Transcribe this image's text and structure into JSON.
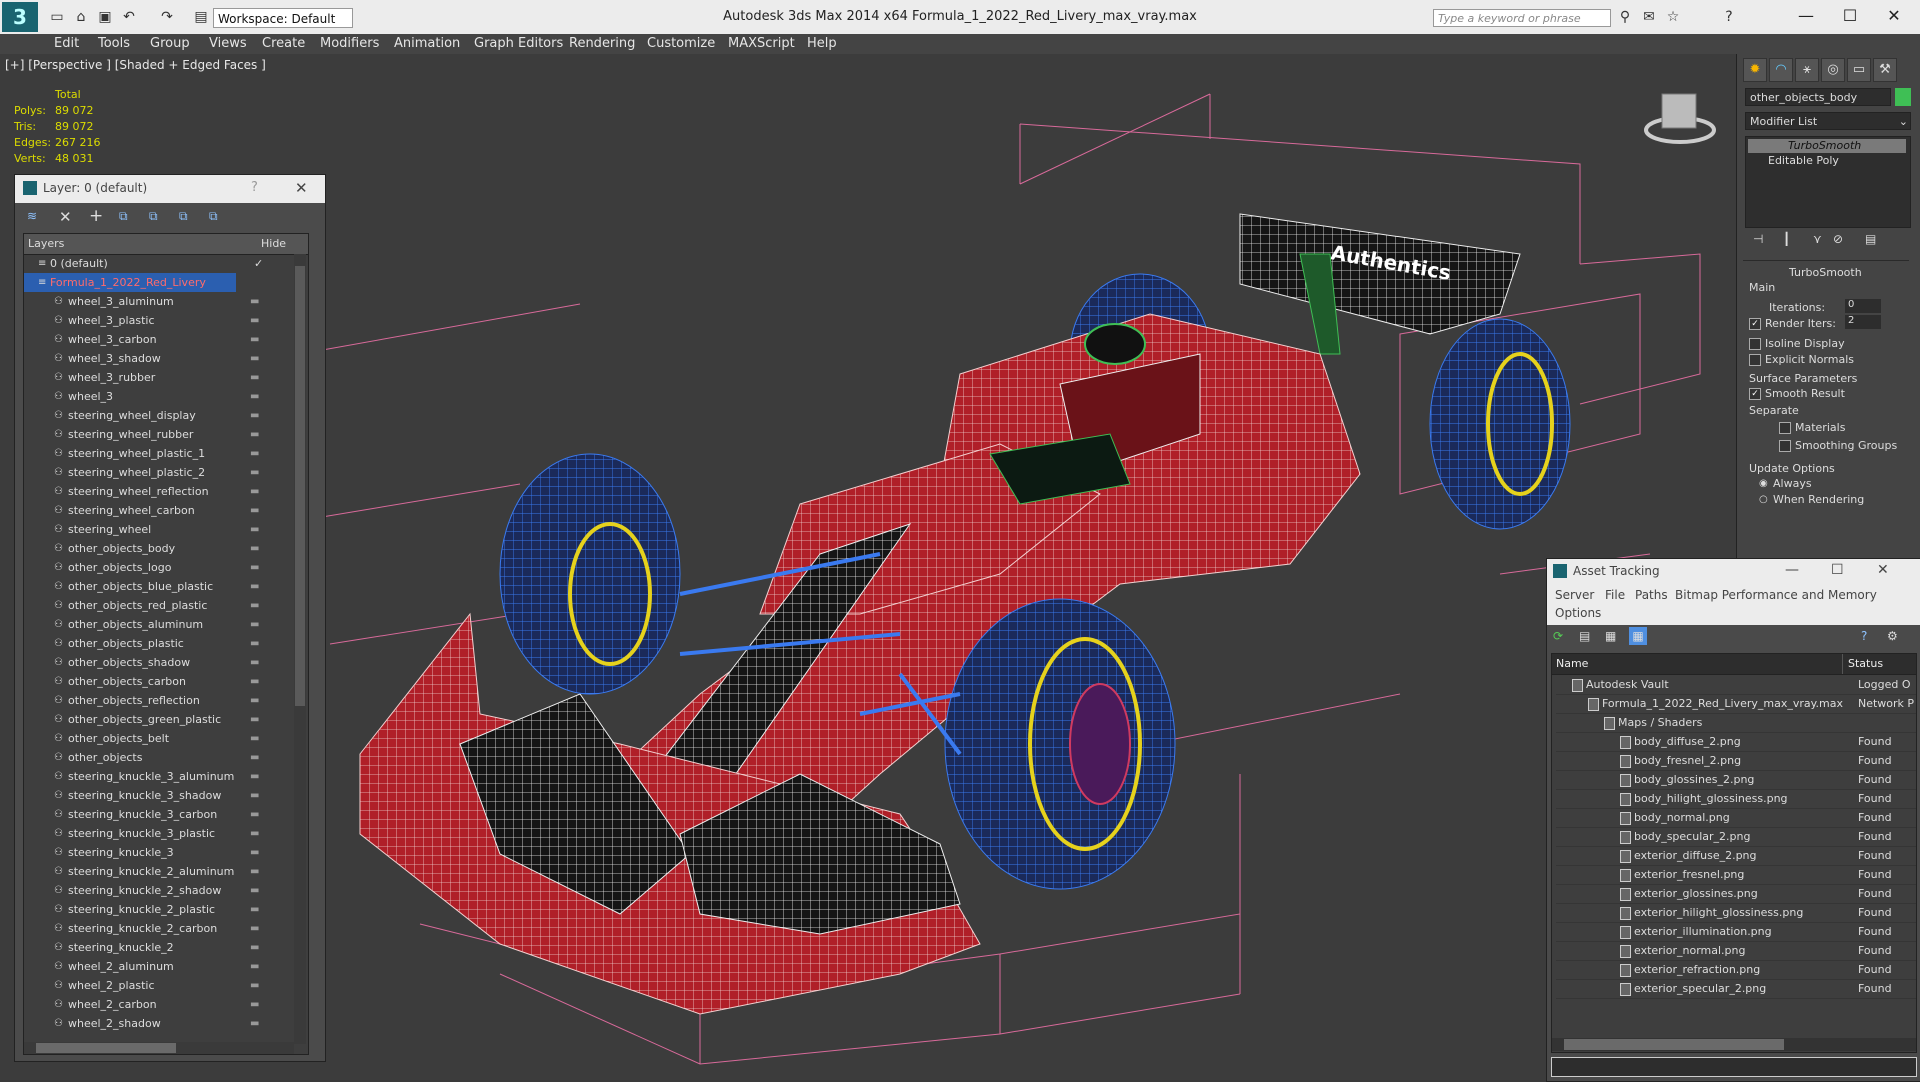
{
  "titlebar": {
    "app_title": "Autodesk 3ds Max  2014 x64      Formula_1_2022_Red_Livery_max_vray.max",
    "workspace": "Workspace: Default",
    "search_placeholder": "Type a keyword or phrase"
  },
  "menu": [
    "Edit",
    "Tools",
    "Group",
    "Views",
    "Create",
    "Modifiers",
    "Animation",
    "Graph Editors",
    "Rendering",
    "Customize",
    "MAXScript",
    "Help"
  ],
  "viewport": {
    "label": "[+] [Perspective ] [Shaded + Edged Faces ]",
    "stats_header": "Total",
    "stats": [
      {
        "label": "Polys:",
        "value": "89 072"
      },
      {
        "label": "Tris:",
        "value": "89 072"
      },
      {
        "label": "Edges:",
        "value": "267 216"
      },
      {
        "label": "Verts:",
        "value": "48 031"
      }
    ],
    "wing_text": "Authentics",
    "colors": {
      "body": "#c0242c",
      "wheels": "#2b6ad6",
      "bg": "#3c3c3c",
      "box": "#d86a9a",
      "green": "#3fbf55"
    }
  },
  "layer_dialog": {
    "title": "Layer: 0 (default)",
    "col_layers": "Layers",
    "col_hide": "Hide",
    "root_layers": [
      "0 (default)",
      "Formula_1_2022_Red_Livery"
    ],
    "objects": [
      "wheel_3_aluminum",
      "wheel_3_plastic",
      "wheel_3_carbon",
      "wheel_3_shadow",
      "wheel_3_rubber",
      "wheel_3",
      "steering_wheel_display",
      "steering_wheel_rubber",
      "steering_wheel_plastic_1",
      "steering_wheel_plastic_2",
      "steering_wheel_reflection",
      "steering_wheel_carbon",
      "steering_wheel",
      "other_objects_body",
      "other_objects_logo",
      "other_objects_blue_plastic",
      "other_objects_red_plastic",
      "other_objects_aluminum",
      "other_objects_plastic",
      "other_objects_shadow",
      "other_objects_carbon",
      "other_objects_reflection",
      "other_objects_green_plastic",
      "other_objects_belt",
      "other_objects",
      "steering_knuckle_3_aluminum",
      "steering_knuckle_3_shadow",
      "steering_knuckle_3_carbon",
      "steering_knuckle_3_plastic",
      "steering_knuckle_3",
      "steering_knuckle_2_aluminum",
      "steering_knuckle_2_shadow",
      "steering_knuckle_2_plastic",
      "steering_knuckle_2_carbon",
      "steering_knuckle_2",
      "wheel_2_aluminum",
      "wheel_2_plastic",
      "wheel_2_carbon",
      "wheel_2_shadow"
    ]
  },
  "command_panel": {
    "object_name": "other_objects_body",
    "modifier_list": "Modifier List",
    "stack": [
      "TurboSmooth",
      "Editable Poly"
    ],
    "rollout_title": "TurboSmooth",
    "main": "Main",
    "iterations_label": "Iterations:",
    "iterations_value": "0",
    "render_iters_label": "Render Iters:",
    "render_iters_value": "2",
    "isoline": "Isoline Display",
    "explicit": "Explicit Normals",
    "surface_params": "Surface Parameters",
    "smooth_result": "Smooth Result",
    "separate": "Separate",
    "materials": "Materials",
    "smoothing_groups": "Smoothing Groups",
    "update_options": "Update Options",
    "always": "Always",
    "when_rendering": "When Rendering"
  },
  "asset_tracking": {
    "title": "Asset Tracking",
    "menu": [
      "Server",
      "File",
      "Paths",
      "Bitmap Performance and Memory"
    ],
    "menu2": "Options",
    "col_name": "Name",
    "col_status": "Status",
    "rows": [
      {
        "name": "Autodesk Vault",
        "status": "Logged O",
        "indent": 1
      },
      {
        "name": "Formula_1_2022_Red_Livery_max_vray.max",
        "status": "Network P",
        "indent": 2
      },
      {
        "name": "Maps / Shaders",
        "status": "",
        "indent": 3
      },
      {
        "name": "body_diffuse_2.png",
        "status": "Found",
        "indent": 4
      },
      {
        "name": "body_fresnel_2.png",
        "status": "Found",
        "indent": 4
      },
      {
        "name": "body_glossines_2.png",
        "status": "Found",
        "indent": 4
      },
      {
        "name": "body_hilight_glossiness.png",
        "status": "Found",
        "indent": 4
      },
      {
        "name": "body_normal.png",
        "status": "Found",
        "indent": 4
      },
      {
        "name": "body_specular_2.png",
        "status": "Found",
        "indent": 4
      },
      {
        "name": "exterior_diffuse_2.png",
        "status": "Found",
        "indent": 4
      },
      {
        "name": "exterior_fresnel.png",
        "status": "Found",
        "indent": 4
      },
      {
        "name": "exterior_glossines.png",
        "status": "Found",
        "indent": 4
      },
      {
        "name": "exterior_hilight_glossiness.png",
        "status": "Found",
        "indent": 4
      },
      {
        "name": "exterior_illumination.png",
        "status": "Found",
        "indent": 4
      },
      {
        "name": "exterior_normal.png",
        "status": "Found",
        "indent": 4
      },
      {
        "name": "exterior_refraction.png",
        "status": "Found",
        "indent": 4
      },
      {
        "name": "exterior_specular_2.png",
        "status": "Found",
        "indent": 4
      }
    ]
  }
}
